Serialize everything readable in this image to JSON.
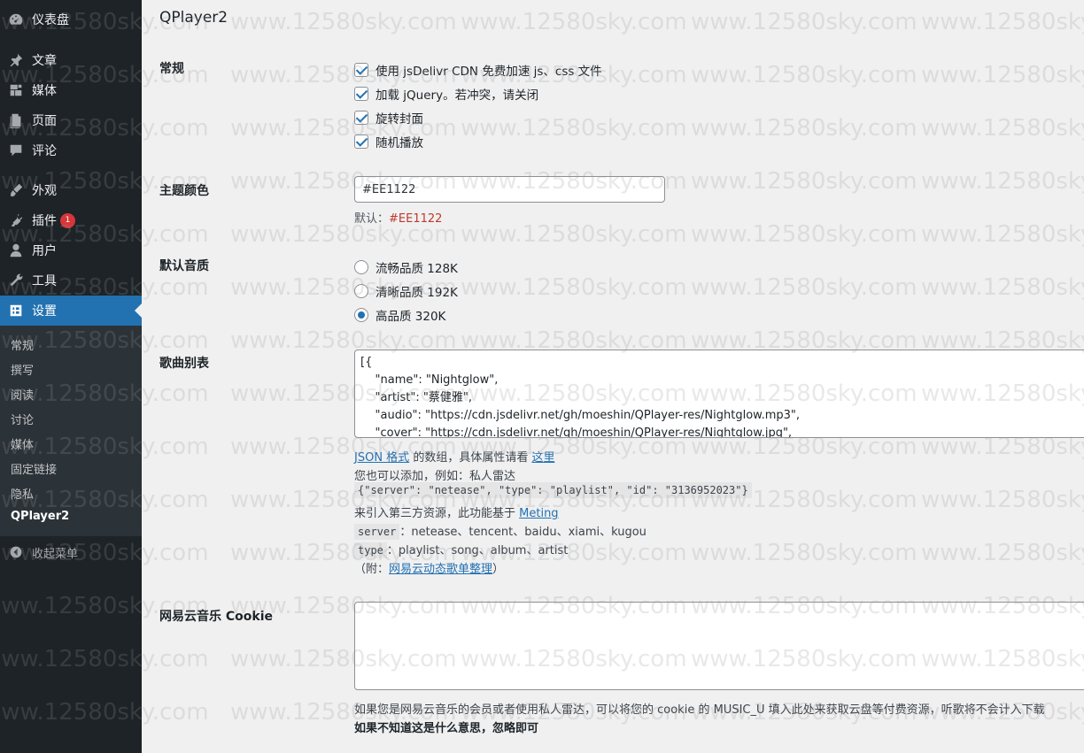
{
  "sidebar": {
    "items": [
      {
        "label": "仪表盘",
        "icon": "dashboard-icon"
      },
      {
        "label": "文章",
        "icon": "pin-icon"
      },
      {
        "label": "媒体",
        "icon": "media-icon"
      },
      {
        "label": "页面",
        "icon": "page-icon"
      },
      {
        "label": "评论",
        "icon": "comment-icon"
      },
      {
        "label": "外观",
        "icon": "appearance-icon"
      },
      {
        "label": "插件",
        "icon": "plugin-icon",
        "badge": "1"
      },
      {
        "label": "用户",
        "icon": "user-icon"
      },
      {
        "label": "工具",
        "icon": "tools-icon"
      },
      {
        "label": "设置",
        "icon": "settings-icon",
        "active": true
      }
    ],
    "submenu": [
      "常规",
      "撰写",
      "阅读",
      "讨论",
      "媒体",
      "固定链接",
      "隐私",
      "QPlayer2"
    ],
    "current_submenu": "QPlayer2",
    "collapse_label": "收起菜单"
  },
  "main": {
    "title": "QPlayer2",
    "general": {
      "label": "常规",
      "options": [
        {
          "label": "使用 jsDelivr CDN 免费加速 js、css 文件",
          "checked": true
        },
        {
          "label": "加载 jQuery。若冲突，请关闭",
          "checked": true
        },
        {
          "label": "旋转封面",
          "checked": true
        },
        {
          "label": "随机播放",
          "checked": true
        }
      ]
    },
    "theme_color": {
      "label": "主题颜色",
      "value": "#EE1122",
      "default_prefix": "默认：",
      "default_value": "#EE1122"
    },
    "quality": {
      "label": "默认音质",
      "options": [
        {
          "label": "流畅品质 128K",
          "checked": false
        },
        {
          "label": "清晰品质 192K",
          "checked": false
        },
        {
          "label": "高品质 320K",
          "checked": true
        }
      ]
    },
    "playlist": {
      "label": "歌曲别表",
      "lines": [
        "[{",
        "    \"name\": \"Nightglow\",",
        "    \"artist\": \"蔡健雅\",",
        "    \"audio\": \"https://cdn.jsdelivr.net/gh/moeshin/QPlayer-res/Nightglow.mp3\",",
        "    \"cover\": \"https://cdn.jsdelivr.net/gh/moeshin/QPlayer-res/Nightglow.jpg\","
      ],
      "help": {
        "json_link": "JSON 格式",
        "mid1": " 的数组，具体属性请看 ",
        "here_link": "这里",
        "line2": "您也可以添加，例如：私人雷达",
        "example_code": "{\"server\": \"netease\", \"type\": \"playlist\", \"id\": \"3136952023\"}",
        "line4_prefix": "来引入第三方资源，此功能基于 ",
        "meting_link": "Meting",
        "server_code": "server",
        "server_values": "：netease、tencent、baidu、xiami、kugou",
        "type_code": "type",
        "type_values": "：playlist、song、album、artist",
        "note_prefix": "（附：",
        "note_link": "网易云动态歌单整理",
        "note_suffix": "）"
      }
    },
    "cookie": {
      "label": "网易云音乐 Cookie",
      "value": "",
      "help": "如果您是网易云音乐的会员或者使用私人雷达，可以将您的 cookie 的 MUSIC_U 填入此处来获取云盘等付费资源，听歌将不会计入下载",
      "help_bold": "如果不知道这是什么意思，忽略即可"
    }
  },
  "watermark": "www.12580sky.com"
}
